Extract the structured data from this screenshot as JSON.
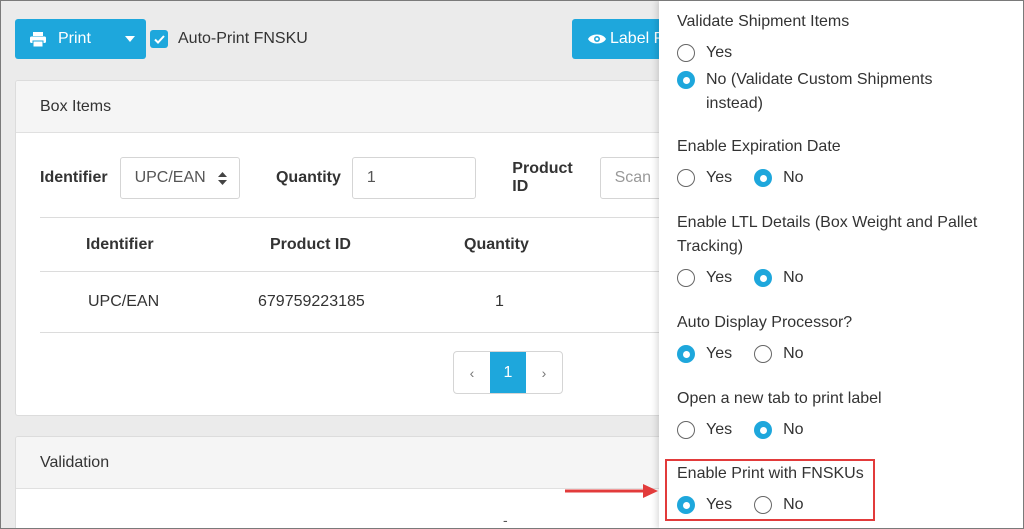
{
  "toolbar": {
    "print_label": "Print",
    "auto_print_label": "Auto-Print FNSKU",
    "label_btn": "Label P"
  },
  "box_items": {
    "title": "Box Items",
    "filters": {
      "identifier_label": "Identifier",
      "identifier_value": "UPC/EAN",
      "quantity_label": "Quantity",
      "quantity_value": "1",
      "product_label": "Product ID",
      "product_placeholder": "Scan"
    },
    "table": {
      "headers": [
        "Identifier",
        "Product ID",
        "Quantity"
      ],
      "rows": [
        [
          "UPC/EAN",
          "679759223185",
          "1"
        ]
      ]
    },
    "pagination": {
      "prev": "‹",
      "current": "1",
      "next": "›"
    }
  },
  "validation": {
    "title": "Validation",
    "dash": "-"
  },
  "settings": {
    "questions": [
      {
        "title": "Validate Shipment Items",
        "options": [
          "Yes",
          "No (Validate Custom Shipments instead)"
        ],
        "selected": 1
      },
      {
        "title": "Enable Expiration Date",
        "options": [
          "Yes",
          "No"
        ],
        "selected": 1
      },
      {
        "title": "Enable LTL Details (Box Weight and Pallet Tracking)",
        "options": [
          "Yes",
          "No"
        ],
        "selected": 1
      },
      {
        "title": "Auto Display Processor?",
        "options": [
          "Yes",
          "No"
        ],
        "selected": 0
      },
      {
        "title": "Open a new tab to print label",
        "options": [
          "Yes",
          "No"
        ],
        "selected": 1
      },
      {
        "title": "Enable Print with FNSKUs",
        "options": [
          "Yes",
          "No"
        ],
        "selected": 0
      }
    ]
  },
  "colors": {
    "accent": "#1ea7dc",
    "highlight": "#e23b3b"
  }
}
